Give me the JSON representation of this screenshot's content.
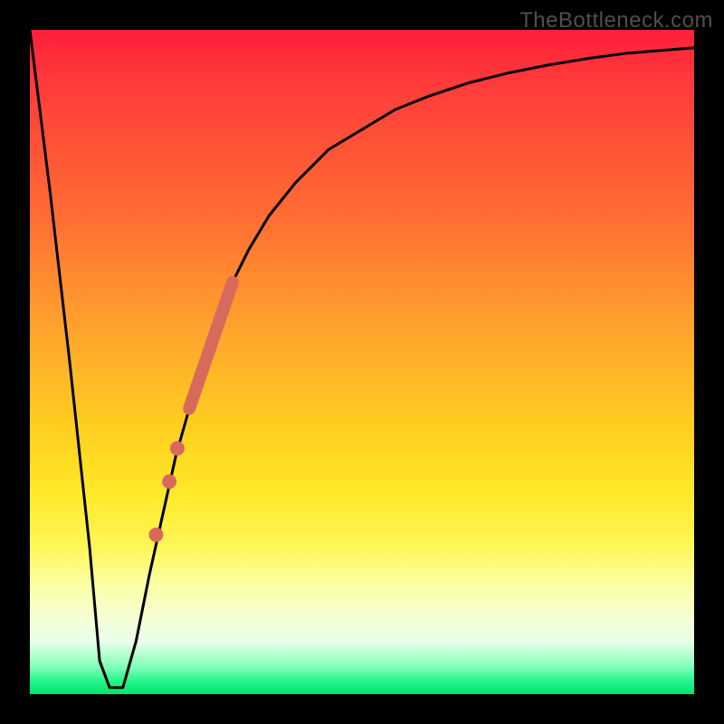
{
  "watermark": "TheBottleneck.com",
  "colors": {
    "frame": "#000000",
    "curve": "#000000",
    "marker": "#d86a5c",
    "marker_outline": "#a24a3f"
  },
  "chart_data": {
    "type": "line",
    "title": "",
    "xlabel": "",
    "ylabel": "",
    "xlim": [
      0,
      100
    ],
    "ylim": [
      0,
      100
    ],
    "grid": false,
    "series": [
      {
        "name": "bottleneck-curve",
        "x": [
          0,
          3,
          6,
          9,
          10.5,
          12,
          14,
          16,
          18,
          20,
          22,
          24,
          26,
          28,
          30,
          33,
          36,
          40,
          45,
          50,
          55,
          60,
          66,
          72,
          78,
          84,
          90,
          95,
          100
        ],
        "y": [
          100,
          76,
          50,
          22,
          5,
          1,
          1,
          8,
          18,
          27,
          36,
          43,
          50,
          56,
          61,
          67,
          72,
          77,
          82,
          85,
          88,
          90,
          92,
          93.5,
          94.7,
          95.7,
          96.5,
          96.9,
          97.3
        ]
      }
    ],
    "markers": [
      {
        "name": "actual-segment",
        "kind": "thick-line",
        "x0": 24,
        "y0": 43,
        "x1": 30.5,
        "y1": 62,
        "width": 14
      },
      {
        "name": "dot-1",
        "kind": "dot",
        "x": 22.2,
        "y": 37,
        "r": 8
      },
      {
        "name": "dot-2",
        "kind": "dot",
        "x": 21.0,
        "y": 32,
        "r": 8
      },
      {
        "name": "dot-3",
        "kind": "dot",
        "x": 19.0,
        "y": 24,
        "r": 8
      }
    ]
  }
}
